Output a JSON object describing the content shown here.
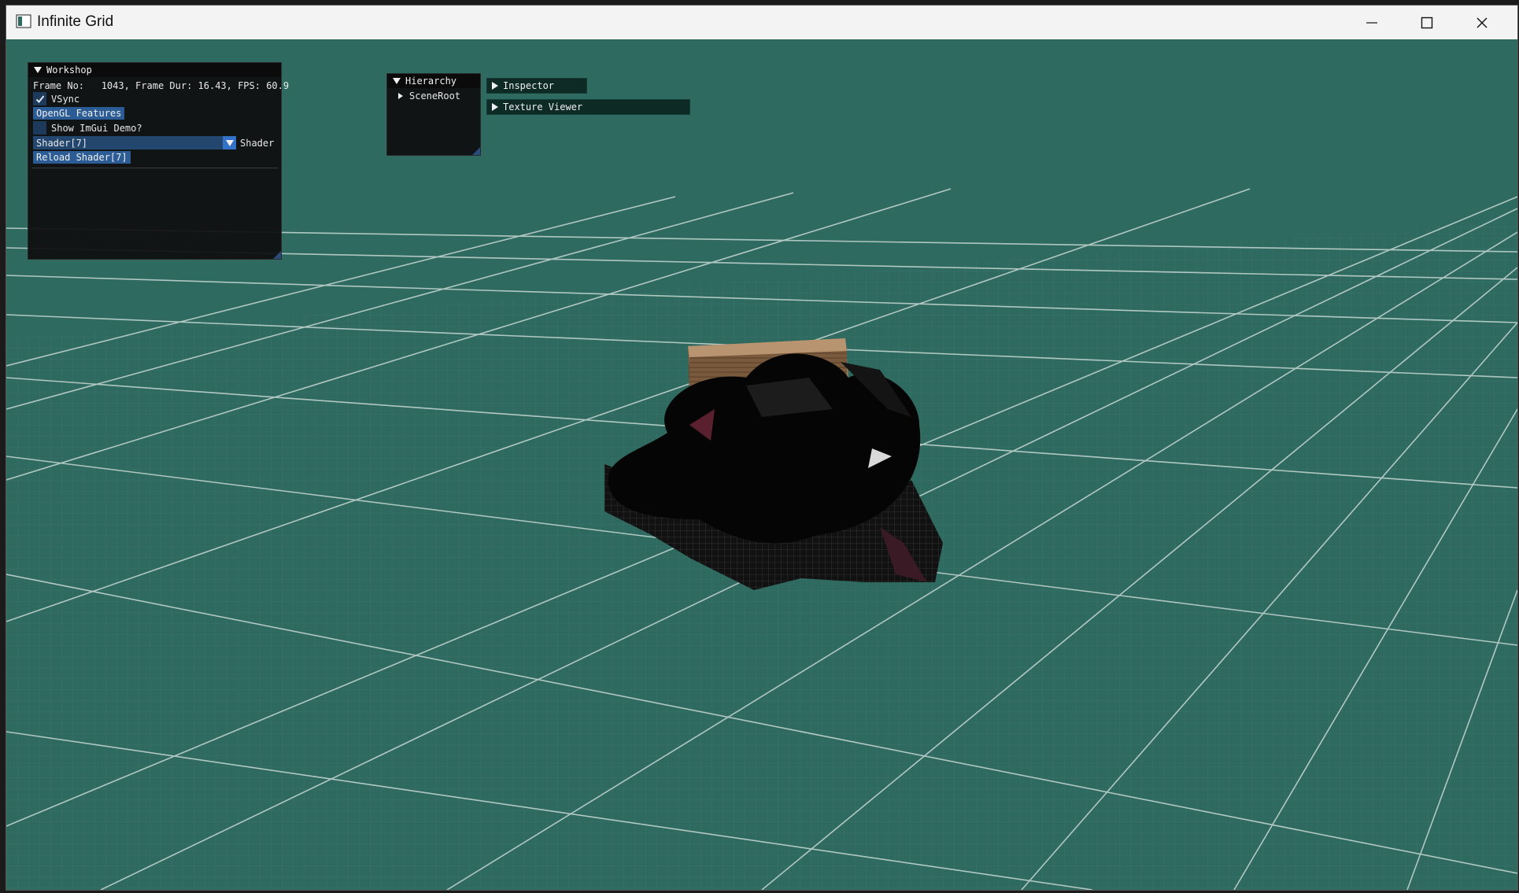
{
  "window": {
    "title": "Infinite Grid",
    "controls": {
      "minimize": "minimize-icon",
      "maximize": "maximize-icon",
      "close": "close-icon"
    }
  },
  "workshop": {
    "title": "Workshop",
    "frame_info": "Frame No:   1043, Frame Dur: 16.43, FPS: 60.9",
    "vsync_label": "VSync",
    "vsync_checked": true,
    "opengl_features_label": "OpenGL Features",
    "show_imgui_demo_label": "Show ImGui Demo?",
    "show_imgui_demo_checked": false,
    "shader_combo_value": "Shader[7]",
    "shader_combo_label": "Shader",
    "reload_shader_label": "Reload Shader[7]"
  },
  "hierarchy": {
    "title": "Hierarchy",
    "items": [
      "SceneRoot"
    ]
  },
  "inspector": {
    "title": "Inspector"
  },
  "texture_viewer": {
    "title": "Texture Viewer"
  },
  "colors": {
    "grid_background": "#2e6a60",
    "panel_background": "#0f0f0f",
    "button": "#2b5c95",
    "checkbox": "#1d3a5a"
  }
}
